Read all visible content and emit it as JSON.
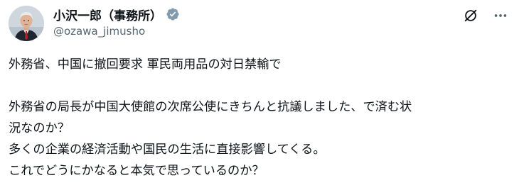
{
  "author": {
    "display_name": "小沢一郎（事務所）",
    "handle": "@ozawa_jimusho",
    "verified": true,
    "verified_color": "#829aab"
  },
  "actions": {
    "grok_icon": "grok-slash-icon",
    "more_icon": "more-horizontal-icon"
  },
  "post": {
    "lines": [
      "外務省、中国に撤回要求 軍民両用品の対日禁輸で",
      "",
      "外務省の局長が中国大使館の次席公使にきちんと抗議しました、で済む状",
      "況なのか？",
      "多くの企業の経済活動や国民の生活に直接影響してくる。",
      "これでどうにかなると本気で思っているのか？"
    ]
  }
}
